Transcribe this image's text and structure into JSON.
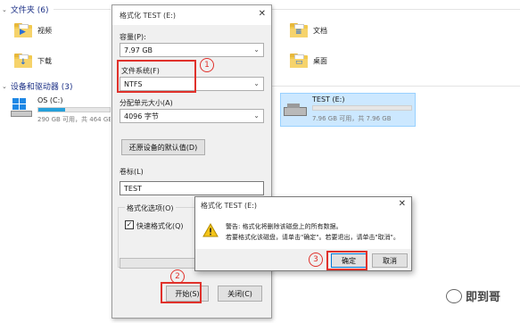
{
  "explorer": {
    "folders_header": "文件夹 (6)",
    "folders": [
      {
        "label": "视频",
        "glyph": "▶"
      },
      {
        "label": "下载",
        "glyph": "↓"
      },
      {
        "label": "文档",
        "glyph": "≡"
      },
      {
        "label": "桌面",
        "glyph": "▭"
      }
    ],
    "devices_header": "设备和驱动器 (3)",
    "drives": [
      {
        "name": "OS (C:)",
        "sub": "290 GB 可用，共 464 GB",
        "fill_fraction": 0.38
      },
      {
        "name": "TEST (E:)",
        "sub": "7.96 GB 可用，共 7.96 GB",
        "fill_fraction": 0.0
      }
    ]
  },
  "format_dialog": {
    "title": "格式化 TEST (E:)",
    "capacity_label": "容量(P):",
    "capacity_value": "7.97 GB",
    "filesystem_label": "文件系统(F)",
    "filesystem_value": "NTFS",
    "alloc_label": "分配单元大小(A)",
    "alloc_value": "4096 字节",
    "restore_button": "还原设备的默认值(D)",
    "volume_label": "卷标(L)",
    "volume_value": "TEST",
    "options_label": "格式化选项(O)",
    "quick_format_label": "快速格式化(Q)",
    "quick_format_checked": true,
    "start_button": "开始(S)",
    "close_button": "关闭(C)"
  },
  "warning_dialog": {
    "title": "格式化 TEST (E:)",
    "line1": "警告: 格式化将删除该磁盘上的所有数据。",
    "line2": "若要格式化该磁盘，请单击\"确定\"。若要退出，请单击\"取消\"。",
    "ok_button": "确定",
    "cancel_button": "取消"
  },
  "annotations": [
    "1",
    "2",
    "3"
  ],
  "watermark": "即到哥",
  "colors": {
    "annotation": "#e0312b",
    "drive_fill": "#26a0da",
    "header_text": "#1e3287"
  }
}
